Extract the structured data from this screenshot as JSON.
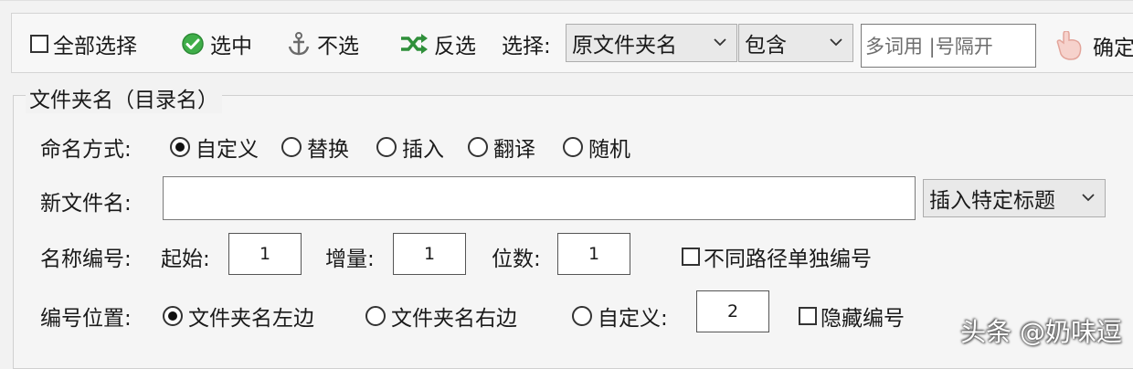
{
  "toolbar": {
    "select_all_label": "全部选择",
    "check_label": "选中",
    "uncheck_label": "不选",
    "invert_label": "反选",
    "select_prefix": "选择:",
    "field_select_value": "原文件夹名",
    "match_select_value": "包含",
    "keywords_placeholder": "多词用 |号隔开",
    "confirm_label": "确定"
  },
  "folder_section": {
    "legend": "文件夹名（目录名）",
    "naming_mode": {
      "label": "命名方式:",
      "options": [
        "自定义",
        "替换",
        "插入",
        "翻译",
        "随机"
      ],
      "selected": "自定义"
    },
    "new_name": {
      "label": "新文件名:",
      "value": "",
      "insert_select_value": "插入特定标题"
    },
    "numbering": {
      "label": "名称编号:",
      "start_label": "起始:",
      "start_value": "1",
      "increment_label": "增量:",
      "increment_value": "1",
      "digits_label": "位数:",
      "digits_value": "1",
      "separate_label": "不同路径单独编号",
      "separate_checked": false
    },
    "number_position": {
      "label": "编号位置:",
      "options": [
        "文件夹名左边",
        "文件夹名右边",
        "自定义:"
      ],
      "selected": "文件夹名左边",
      "custom_value": "2",
      "hide_label": "隐藏编号",
      "hide_checked": false
    }
  },
  "watermark": "头条 @奶味逗",
  "colors": {
    "check_icon": "#3fae49",
    "invert_icon": "#2f8f3a",
    "anchor_icon": "#6b6b6b",
    "hand_icon": "#f4c6c0"
  }
}
